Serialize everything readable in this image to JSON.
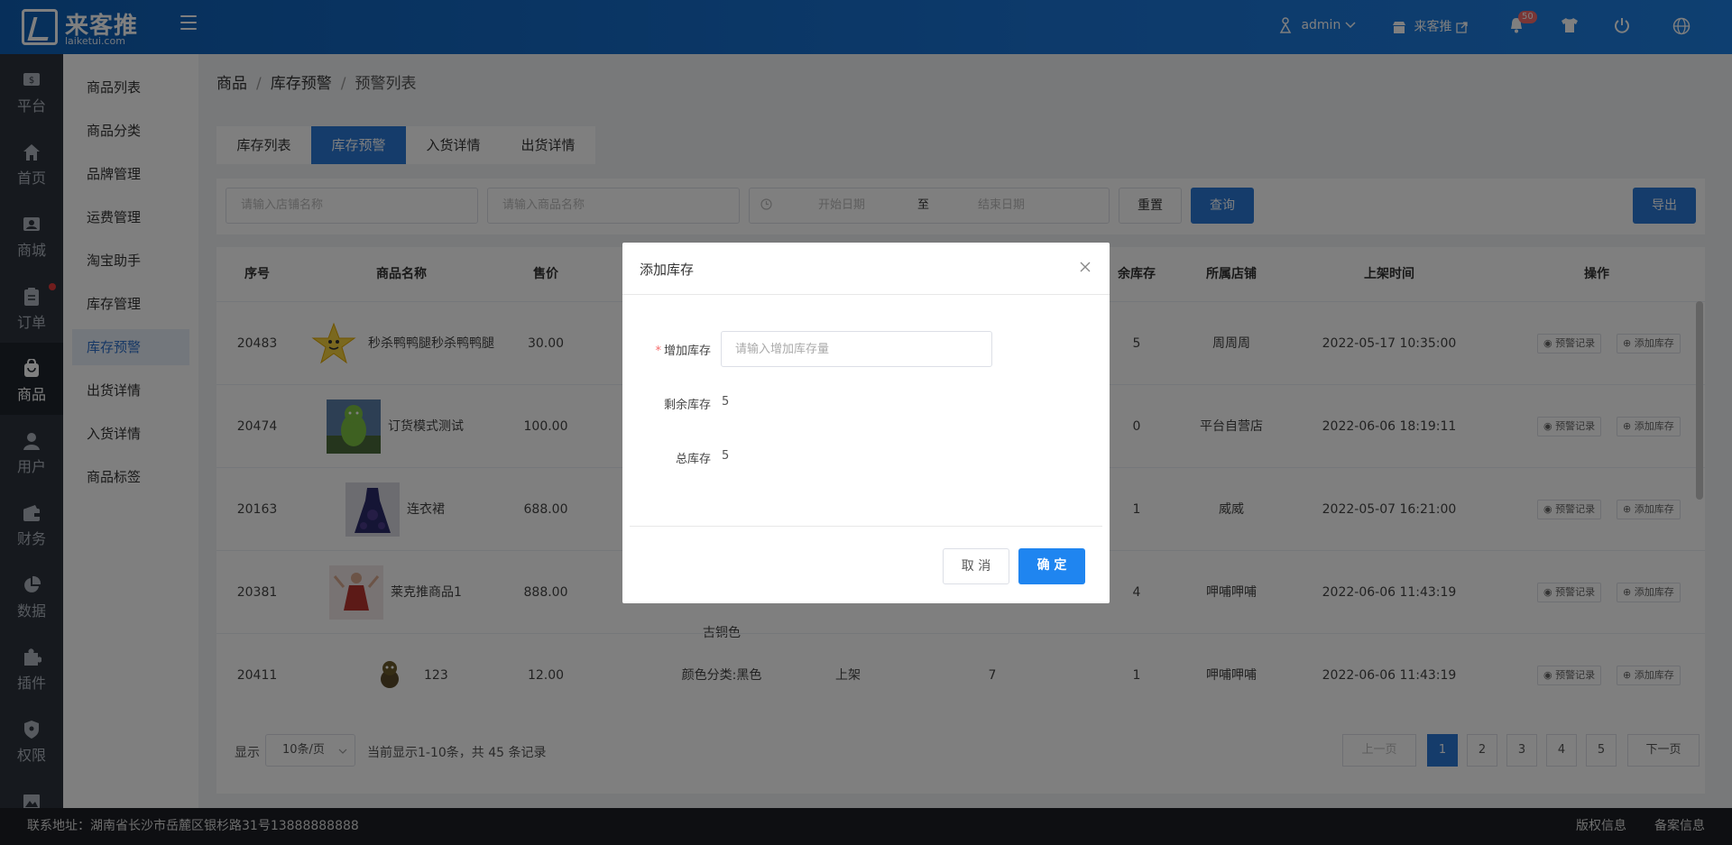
{
  "brand": {
    "name": "来客推",
    "url": "laiketui.com"
  },
  "header": {
    "user": "admin",
    "store": "来客推",
    "notification_count": "50"
  },
  "leftnav": [
    {
      "label": "平台",
      "icon": "dollar-icon"
    },
    {
      "label": "首页",
      "icon": "home-icon"
    },
    {
      "label": "商城",
      "icon": "store-icon"
    },
    {
      "label": "订单",
      "icon": "order-icon",
      "dot": true
    },
    {
      "label": "商品",
      "icon": "goods-icon",
      "active": true
    },
    {
      "label": "用户",
      "icon": "user-icon"
    },
    {
      "label": "财务",
      "icon": "wallet-icon"
    },
    {
      "label": "数据",
      "icon": "pie-chart-icon"
    },
    {
      "label": "插件",
      "icon": "puzzle-icon"
    },
    {
      "label": "权限",
      "icon": "shield-icon"
    },
    {
      "label": "",
      "icon": "image-icon"
    }
  ],
  "subnav": [
    {
      "label": "商品列表"
    },
    {
      "label": "商品分类"
    },
    {
      "label": "品牌管理"
    },
    {
      "label": "运费管理"
    },
    {
      "label": "淘宝助手"
    },
    {
      "label": "库存管理"
    },
    {
      "label": "库存预警",
      "active": true
    },
    {
      "label": "出货详情"
    },
    {
      "label": "入货详情"
    },
    {
      "label": "商品标签"
    }
  ],
  "breadcrumb": [
    "商品",
    "库存预警",
    "预警列表"
  ],
  "tabs": [
    {
      "label": "库存列表"
    },
    {
      "label": "库存预警",
      "active": true
    },
    {
      "label": "入货详情"
    },
    {
      "label": "出货详情"
    }
  ],
  "filter": {
    "store_placeholder": "请输入店铺名称",
    "goods_placeholder": "请输入商品名称",
    "start_placeholder": "开始日期",
    "range_sep": "至",
    "end_placeholder": "结束日期",
    "reset": "重置",
    "search": "查询",
    "export": "导出"
  },
  "table": {
    "headers": [
      "序号",
      "商品名称",
      "售价",
      "余库存",
      "所属店铺",
      "上架时间",
      "操作"
    ],
    "rows": [
      {
        "id": "20483",
        "name": "秒杀鸭鸭腿秒杀鸭鸭腿",
        "price": "30.00",
        "spec": "",
        "status": "",
        "total": "",
        "remain": "5",
        "store": "周周周",
        "time": "2022-05-17 10:35:00"
      },
      {
        "id": "20474",
        "name": "订货模式测试",
        "price": "100.00",
        "spec": "",
        "status": "",
        "total": "",
        "remain": "0",
        "store": "平台自营店",
        "time": "2022-06-06 18:19:11"
      },
      {
        "id": "20163",
        "name": "连衣裙",
        "price": "688.00",
        "spec": "",
        "status": "",
        "total": "",
        "remain": "1",
        "store": "威威",
        "time": "2022-05-07 16:21:00"
      },
      {
        "id": "20381",
        "name": "莱克推商品1",
        "price": "888.00",
        "spec": "古铜色",
        "status": "",
        "total": "",
        "remain": "4",
        "store": "呷哺呷哺",
        "time": "2022-06-06 11:43:19"
      },
      {
        "id": "20411",
        "name": "123",
        "price": "12.00",
        "spec": "颜色分类:黑色",
        "status": "上架",
        "total": "7",
        "remain": "1",
        "store": "呷哺呷哺",
        "time": "2022-06-06 11:43:19"
      }
    ],
    "op_record": "预警记录",
    "op_add": "添加库存"
  },
  "pager": {
    "show": "显示",
    "page_size": "10条/页",
    "summary": "当前显示1-10条，共 45 条记录",
    "prev": "上一页",
    "pages": [
      "1",
      "2",
      "3",
      "4",
      "5"
    ],
    "next": "下一页"
  },
  "footer": {
    "address": "联系地址：湖南省长沙市岳麓区银杉路31号13888888888",
    "copyright": "版权信息",
    "record": "备案信息"
  },
  "modal": {
    "title": "添加库存",
    "add_label": "增加库存",
    "add_placeholder": "请输入增加库存量",
    "remain_label": "剩余库存",
    "remain_value": "5",
    "total_label": "总库存",
    "total_value": "5",
    "cancel": "取 消",
    "confirm": "确 定"
  },
  "colors": {
    "primary": "#2a78d6",
    "danger": "#f56c6c",
    "nav_dark": "#2c333c"
  }
}
